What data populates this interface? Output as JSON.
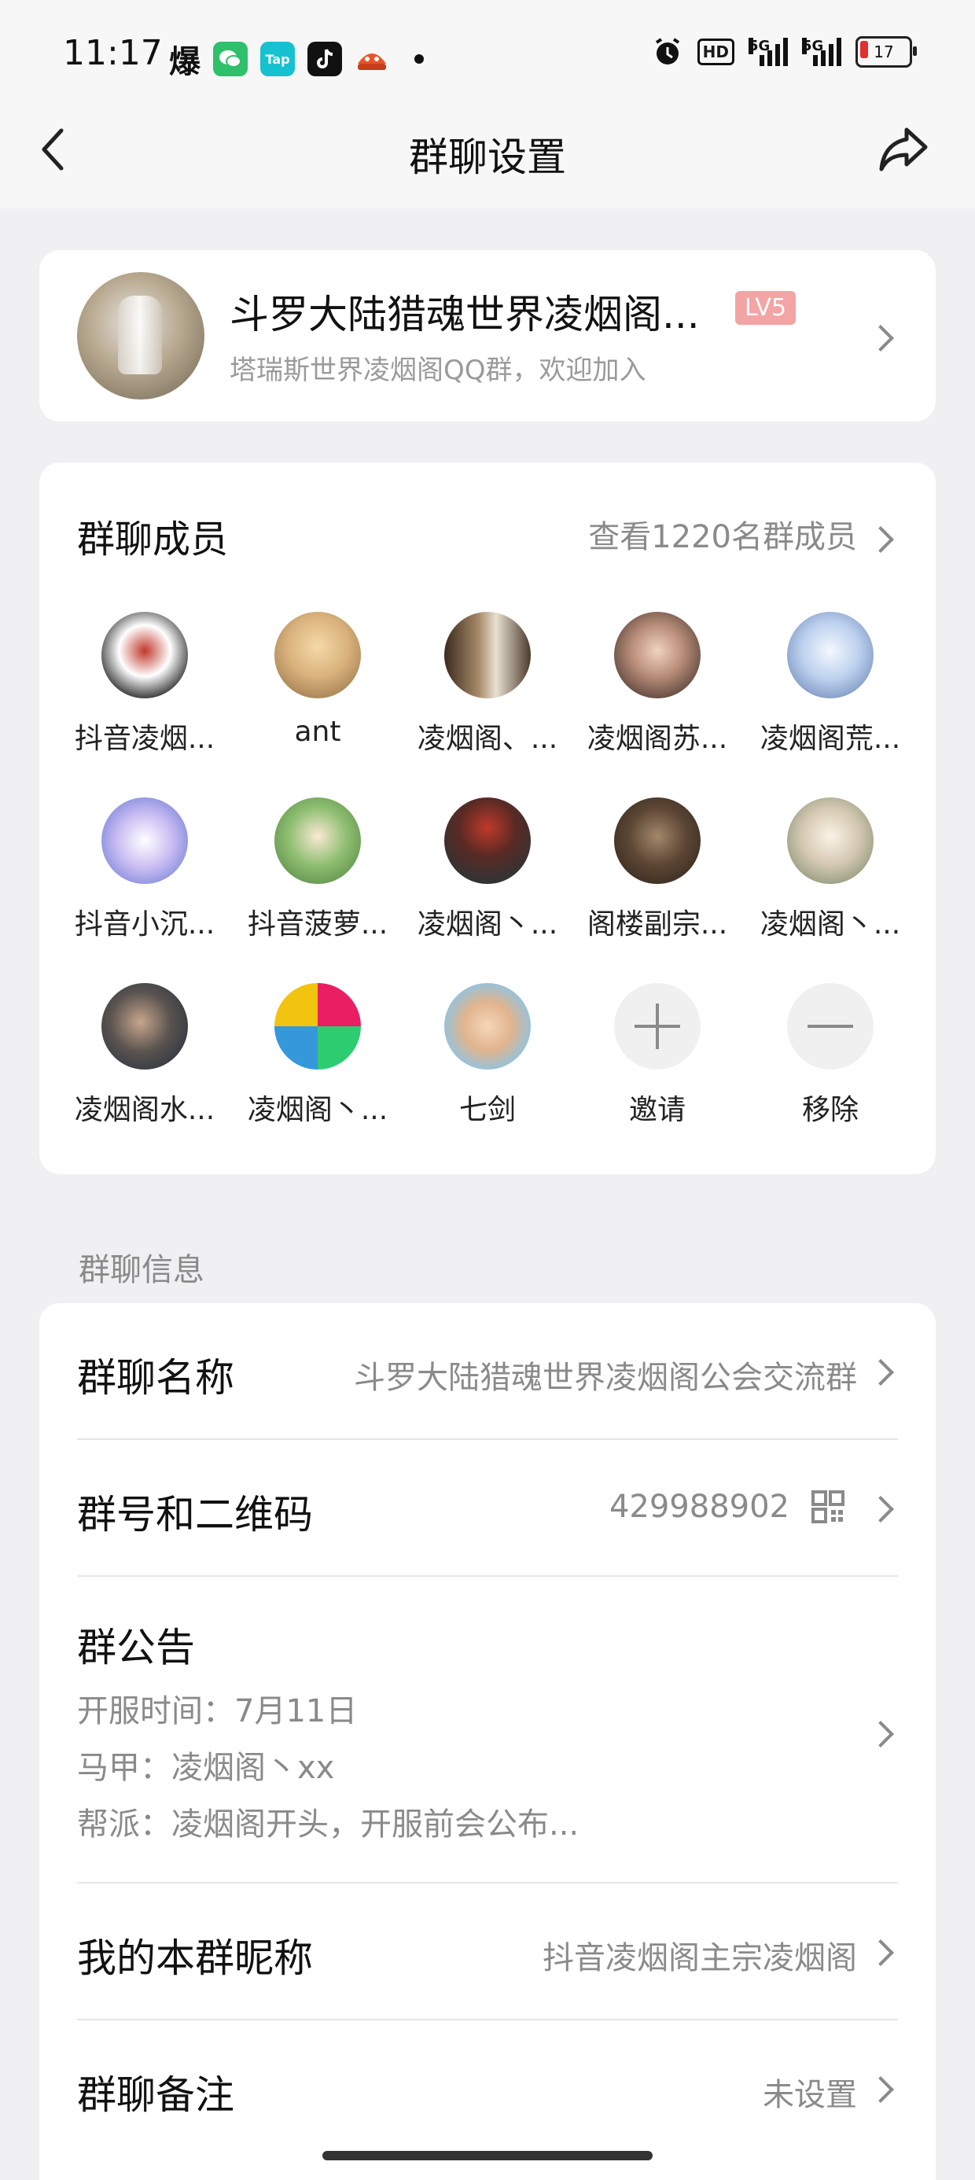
{
  "status_bar": {
    "time": "11:17",
    "left_icons": [
      "explode-glyph",
      "wechat-icon",
      "taptap-icon",
      "tiktok-icon",
      "game-icon"
    ],
    "right_icons": [
      "alarm-icon",
      "hd-icon",
      "signal-5g-icon",
      "signal-5g-icon",
      "battery-icon"
    ],
    "hd_label": "HD",
    "net1_label": "5G",
    "net2_label": "5G",
    "battery_level": "17",
    "explode_char": "爆",
    "tap_label": "Tap"
  },
  "nav": {
    "title": "群聊设置",
    "back_icon": "back-arrow-icon",
    "share_icon": "share-icon"
  },
  "group": {
    "name": "斗罗大陆猎魂世界凌烟阁...",
    "level": "LV5",
    "description": "塔瑞斯世界凌烟阁QQ群，欢迎加入"
  },
  "members": {
    "title": "群聊成员",
    "view_all": "查看1220名群成员",
    "list": [
      {
        "name": "抖音凌烟...",
        "bg": "radial-gradient(circle at 50% 45%, #c0392b 0%, #ffffff 40%, #3a3a3a 75%, #ffffff 100%)"
      },
      {
        "name": "ant",
        "bg": "radial-gradient(circle at 50% 40%, #f5d9a8 0%, #d9b27c 45%, #8b6a40 100%)"
      },
      {
        "name": "凌烟阁、...",
        "bg": "linear-gradient(90deg, #3b2a1e 0%, #a88a6a 40%, #e9e0d2 60%, #4c3a2c 100%)"
      },
      {
        "name": "凌烟阁苏...",
        "bg": "radial-gradient(circle at 50% 45%, #f1d3c2 0%, #b98e7a 40%, #2b1f1b 100%)"
      },
      {
        "name": "凌烟阁荒...",
        "bg": "radial-gradient(circle at 50% 45%, #f5f8ff 0%, #bcd0ee 45%, #5a76a8 100%)"
      },
      {
        "name": "抖音小沉...",
        "bg": "radial-gradient(circle at 50% 50%, #ffffff 0%, #c9bdf2 45%, #5c6fd1 100%)"
      },
      {
        "name": "抖音菠萝...",
        "bg": "radial-gradient(circle at 50% 45%, #fbe9d4 0%, #8fbf72 45%, #4b7d3b 100%)"
      },
      {
        "name": "凌烟阁丶...",
        "bg": "radial-gradient(circle at 50% 35%, #c0392b 0%, #5a2a24 40%, #2f3436 80%, #4f5456 100%)"
      },
      {
        "name": "阁楼副宗...",
        "bg": "radial-gradient(circle at 50% 45%, #a3876b 0%, #5c4634 45%, #2a211a 100%)"
      },
      {
        "name": "凌烟阁丶...",
        "bg": "radial-gradient(circle at 50% 45%, #fbf3e6 0%, #d4c8b2 45%, #6f8061 100%)"
      },
      {
        "name": "凌烟阁水...",
        "bg": "radial-gradient(circle at 45% 45%, #c7a58c 0%, #5a5350 45%, #1d2a3a 100%)"
      },
      {
        "name": "凌烟阁丶...",
        "bg": "conic-gradient(#e91e63 0 25%, #2ecc71 0 50%, #3498db 0 75%, #f1c40f 0)"
      },
      {
        "name": "七剑",
        "bg": "radial-gradient(circle at 50% 50%, #f6d6b8 0%, #e0b48e 40%, #8fc4e2 75%, #6faed4 100%)"
      }
    ],
    "invite": "邀请",
    "remove": "移除"
  },
  "info": {
    "section_label": "群聊信息",
    "name_label": "群聊名称",
    "name_value": "斗罗大陆猎魂世界凌烟阁公会交流群",
    "number_label": "群号和二维码",
    "number_value": "429988902",
    "notice_label": "群公告",
    "notice_lines": [
      "开服时间：7月11日",
      "马甲：凌烟阁丶xx",
      "帮派：凌烟阁开头，开服前会公布..."
    ],
    "nickname_label": "我的本群昵称",
    "nickname_value": "抖音凌烟阁主宗凌烟阁",
    "remark_label": "群聊备注",
    "remark_value": "未设置"
  },
  "colors": {
    "background": "#f0f0f2",
    "card": "#ffffff",
    "secondary_text": "#8a8a8a",
    "level_badge": "#f3a4a4"
  }
}
